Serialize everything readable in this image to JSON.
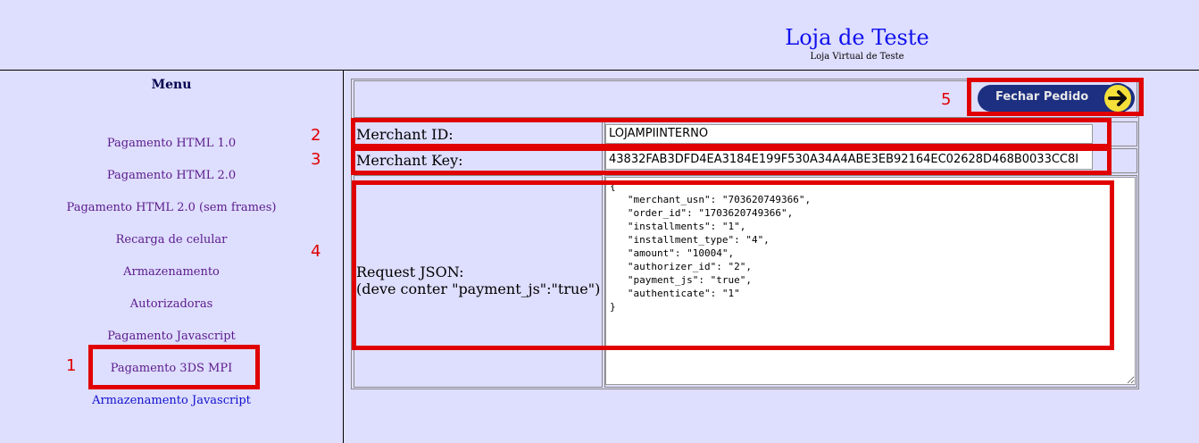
{
  "header": {
    "title": "Loja de Teste",
    "subtitle": "Loja Virtual de Teste"
  },
  "sidebar": {
    "title": "Menu",
    "items": [
      {
        "label": "Pagamento HTML 1.0"
      },
      {
        "label": "Pagamento HTML 2.0"
      },
      {
        "label": "Pagamento HTML 2.0 (sem frames)"
      },
      {
        "label": "Recarga de celular"
      },
      {
        "label": "Armazenamento"
      },
      {
        "label": "Autorizadoras"
      },
      {
        "label": "Pagamento Javascript"
      },
      {
        "label": "Pagamento 3DS MPI"
      },
      {
        "label": "Armazenamento Javascript"
      }
    ]
  },
  "form": {
    "close_button": "Fechar Pedido",
    "merchant_id_label": "Merchant ID:",
    "merchant_id_value": "LOJAMPIINTERNO",
    "merchant_key_label": "Merchant Key:",
    "merchant_key_value": "43832FAB3DFD4EA3184E199F530A34A4ABE3EB92164EC02628D468B0033CC8I",
    "request_json_label": "Request JSON:",
    "request_json_hint": "(deve conter \"payment_js\":\"true\")",
    "request_json_value": "{\n   \"merchant_usn\": \"703620749366\",\n   \"order_id\": \"1703620749366\",\n   \"installments\": \"1\",\n   \"installment_type\": \"4\",\n   \"amount\": \"10004\",\n   \"authorizer_id\": \"2\",\n   \"payment_js\": \"true\",\n   \"authenticate\": \"1\"\n}"
  },
  "annotations": {
    "n1": "1",
    "n2": "2",
    "n3": "3",
    "n4": "4",
    "n5": "5"
  },
  "colors": {
    "background": "#dedeff",
    "annotation_red": "#e00000",
    "title_blue": "#1010ee",
    "button_navy": "#1c2f80",
    "arrow_yellow": "#f5e03a"
  },
  "icons": {
    "close_button_icon": "arrow-right-circle-icon"
  }
}
